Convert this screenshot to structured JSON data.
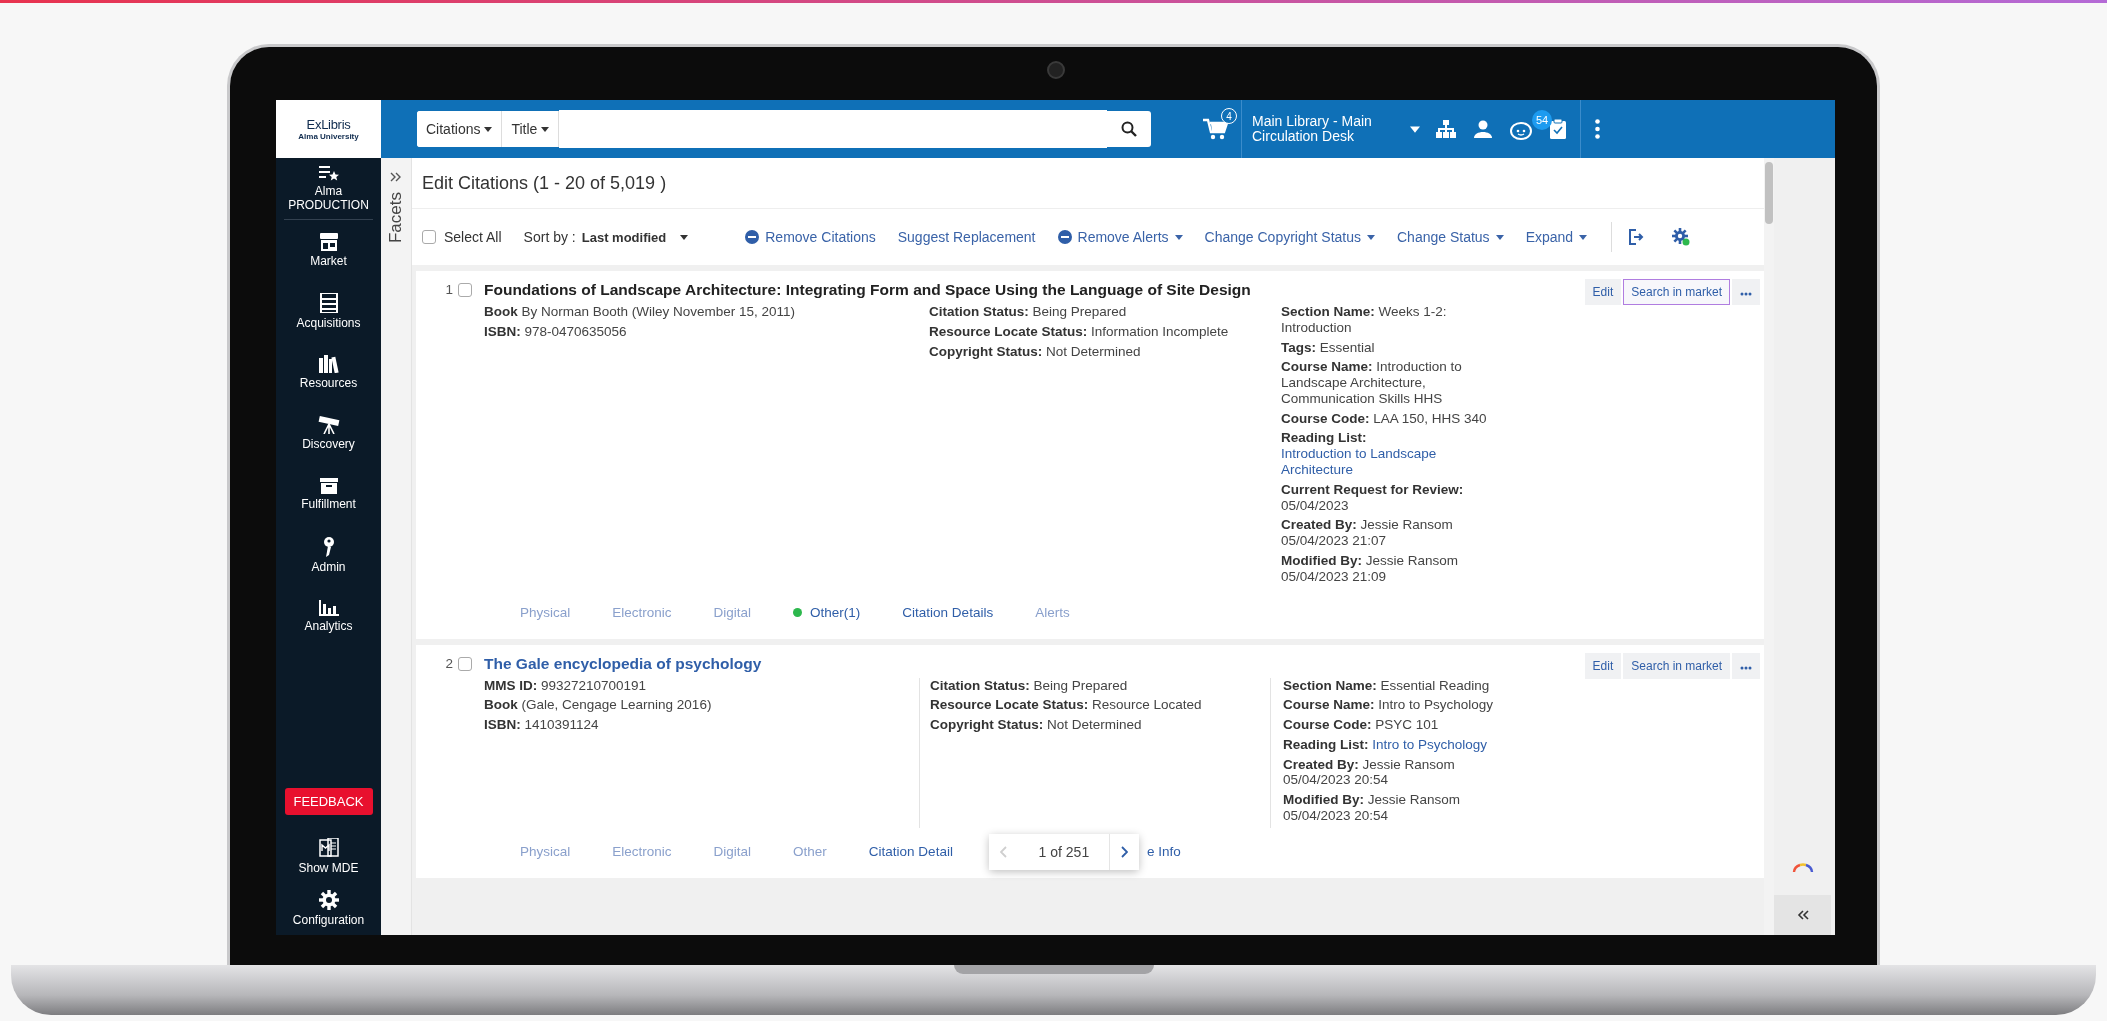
{
  "sidebar": {
    "logo": {
      "brand": "ExLibris",
      "subtitle": "Alma University"
    },
    "items": [
      {
        "label": "Alma PRODUCTION"
      },
      {
        "label": "Market"
      },
      {
        "label": "Acquisitions"
      },
      {
        "label": "Resources"
      },
      {
        "label": "Discovery"
      },
      {
        "label": "Fulfillment"
      },
      {
        "label": "Admin"
      },
      {
        "label": "Analytics"
      }
    ],
    "feedback": "FEEDBACK",
    "bottom_items": [
      {
        "label": "Show MDE"
      },
      {
        "label": "Configuration"
      }
    ]
  },
  "topbar": {
    "search": {
      "scopes": [
        {
          "label": "Citations"
        },
        {
          "label": "Title"
        }
      ]
    },
    "cart_count": "4",
    "location": "Main Library - Main Circulation Desk",
    "notifications_count": "54"
  },
  "facets": "Facets",
  "header": {
    "title": "Edit Citations (1 - 20 of 5,019 )"
  },
  "toolbar": {
    "select_all": {
      "label": "Select All",
      "checked": false
    },
    "sort": {
      "label": "Sort by :",
      "value": "Last modified"
    },
    "actions": [
      {
        "label": "Remove Citations",
        "kind": "remove"
      },
      {
        "label": "Suggest Replacement",
        "kind": "link"
      },
      {
        "label": "Remove Alerts",
        "kind": "remove-menu"
      },
      {
        "label": "Change Copyright Status",
        "kind": "menu"
      },
      {
        "label": "Change Status",
        "kind": "menu"
      },
      {
        "label": "Expand",
        "kind": "menu"
      }
    ]
  },
  "records": [
    {
      "number": "1",
      "checked": false,
      "title": {
        "text": "Foundations of Landscape Architecture: Integrating Form and Space Using the Language of Site Design",
        "link": false
      },
      "dividers": false,
      "actions": [
        {
          "label": "Edit",
          "focused": false
        },
        {
          "label": "Search in market",
          "focused": true
        }
      ],
      "column_1": [
        {
          "label": "Book",
          "value": "By Norman Booth (Wiley November 15, 2011)"
        },
        {
          "label": "ISBN:",
          "value": "978-0470635056"
        }
      ],
      "column_2": [
        {
          "label": "Citation Status:",
          "value": "Being Prepared"
        },
        {
          "label": "Resource Locate Status:",
          "value": "Information Incomplete"
        },
        {
          "label": "Copyright Status:",
          "value": "Not Determined"
        }
      ],
      "column_3": [
        {
          "label": "Section Name:",
          "value": "Weeks 1-2: Introduction"
        },
        {
          "label": "Tags:",
          "value": "Essential"
        },
        {
          "label": "Course Name:",
          "value": "Introduction to Landscape Architecture, Communication Skills HHS"
        },
        {
          "label": "Course Code:",
          "value": "LAA 150, HHS 340"
        },
        {
          "label": "Reading List:",
          "value": "Introduction to Landscape Architecture",
          "link": true
        },
        {
          "label": "Current Request for Review:",
          "value": "05/04/2023"
        },
        {
          "label": "Created By:",
          "value": "Jessie Ransom 05/04/2023 21:07"
        },
        {
          "label": "Modified By:",
          "value": "Jessie Ransom 05/04/2023 21:09"
        }
      ],
      "links": [
        {
          "label": "Physical",
          "disabled": true
        },
        {
          "label": "Electronic",
          "disabled": true
        },
        {
          "label": "Digital",
          "disabled": true
        },
        {
          "label": "Other(1)",
          "disabled": false,
          "color": "#2db84d"
        },
        {
          "label": "Citation Details",
          "disabled": false
        },
        {
          "label": "Alerts",
          "disabled": true
        }
      ]
    },
    {
      "number": "2",
      "checked": false,
      "title": {
        "text": "The Gale encyclopedia of psychology",
        "link": true
      },
      "dividers": true,
      "actions": [
        {
          "label": "Edit",
          "focused": false
        },
        {
          "label": "Search in market",
          "focused": false
        }
      ],
      "column_1": [
        {
          "label": "MMS ID:",
          "value": "99327210700191"
        },
        {
          "label": "Book",
          "value": "(Gale, Cengage Learning 2016)"
        },
        {
          "label": "ISBN:",
          "value": "1410391124"
        }
      ],
      "column_2": [
        {
          "label": "Citation Status:",
          "value": "Being Prepared"
        },
        {
          "label": "Resource Locate Status:",
          "value": "Resource Located"
        },
        {
          "label": "Copyright Status:",
          "value": "Not Determined"
        }
      ],
      "column_3": [
        {
          "label": "Section Name:",
          "value": "Essential Reading"
        },
        {
          "label": "Course Name:",
          "value": "Intro to Psychology"
        },
        {
          "label": "Course Code:",
          "value": "PSYC 101"
        },
        {
          "label": "Reading List:",
          "value": "Intro to Psychology",
          "link": true
        },
        {
          "label": "Created By:",
          "value": "Jessie Ransom 05/04/2023 20:54"
        },
        {
          "label": "Modified By:",
          "value": "Jessie Ransom 05/04/2023 20:54"
        }
      ],
      "links": [
        {
          "label": "Physical",
          "disabled": true
        },
        {
          "label": "Electronic",
          "disabled": true
        },
        {
          "label": "Digital",
          "disabled": true
        },
        {
          "label": "Other",
          "disabled": true
        },
        {
          "label": "Citation Detail",
          "disabled": false
        },
        {
          "label": "e Info",
          "disabled": false
        }
      ]
    }
  ],
  "pagination": {
    "label": "1 of 251",
    "prev_disabled": true
  }
}
